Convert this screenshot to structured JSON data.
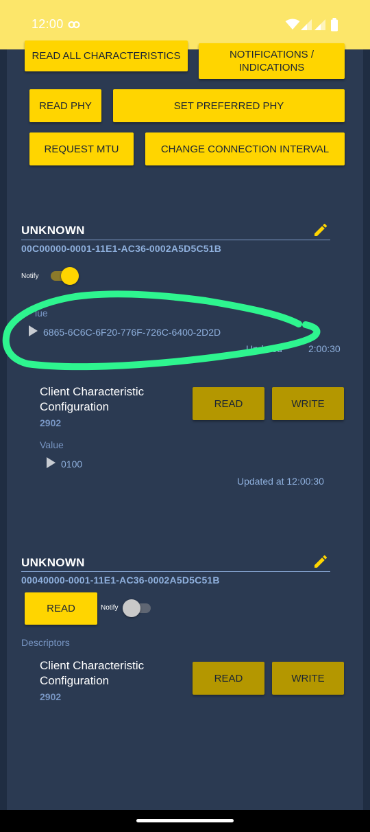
{
  "status_bar": {
    "time": "12:00",
    "icons": [
      "link-icon",
      "wifi-icon",
      "signal-icon",
      "signal-icon",
      "battery-icon"
    ]
  },
  "actions": {
    "read_all": "READ ALL CHARACTERISTICS",
    "notifications": "NOTIFICATIONS / INDICATIONS",
    "read_phy": "READ PHY",
    "set_preferred_phy": "SET PREFERRED PHY",
    "request_mtu": "REQUEST MTU",
    "change_interval": "CHANGE CONNECTION INTERVAL"
  },
  "characteristic_1": {
    "title": "UNKNOWN",
    "uuid": "00C00000-0001-11E1-AC36-0002A5D5C51B",
    "notify_label": "Notify",
    "notify_on": true,
    "value_label": "lue",
    "value": "6865-6C6C-6F20-776F-726C-6400-2D2D",
    "updated_a": "Updated",
    "updated_b": "2:00:30",
    "descriptor": {
      "name": "Client Characteristic Configuration",
      "uuid": "2902",
      "read_label": "READ",
      "write_label": "WRITE",
      "value_label": "Value",
      "value": "0100",
      "updated": "Updated at 12:00:30"
    }
  },
  "characteristic_2": {
    "title": "UNKNOWN",
    "uuid": "00040000-0001-11E1-AC36-0002A5D5C51B",
    "read_label": "READ",
    "notify_label": "Notify",
    "notify_on": false,
    "descriptors_label": "Descriptors",
    "descriptor": {
      "name": "Client Characteristic Configuration",
      "uuid": "2902",
      "read_label": "READ",
      "write_label": "WRITE"
    }
  },
  "colors": {
    "accent": "#ffd500",
    "dark_accent": "#b49700",
    "panel": "#2b3a52",
    "background": "#1f2d42",
    "annotation": "#2ef58f"
  }
}
